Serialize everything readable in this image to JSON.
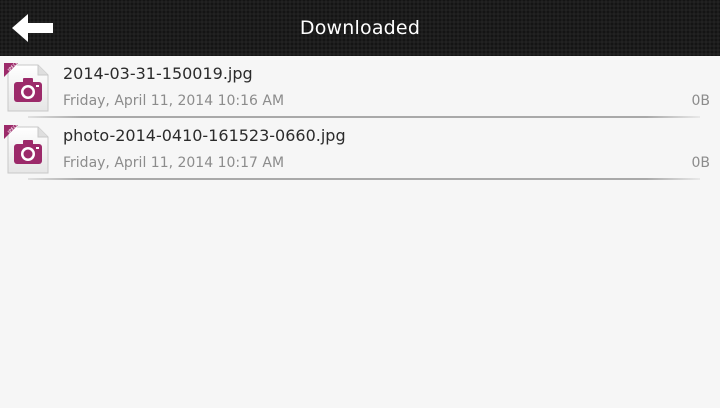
{
  "header": {
    "title": "Downloaded",
    "back_icon": "back-arrow-icon"
  },
  "files": [
    {
      "name": "2014-03-31-150019.jpg",
      "date": "Friday, April 11, 2014 10:16 AM",
      "size": "0B",
      "icon": "jpeg-file-icon",
      "badge": "JPEG"
    },
    {
      "name": "photo-2014-0410-161523-0660.jpg",
      "date": "Friday, April 11, 2014 10:17 AM",
      "size": "0B",
      "icon": "jpeg-file-icon",
      "badge": "JPEG"
    }
  ],
  "colors": {
    "titlebar": "#1c1c1c",
    "background": "#f6f6f6",
    "icon_accent": "#9c2a6a"
  }
}
